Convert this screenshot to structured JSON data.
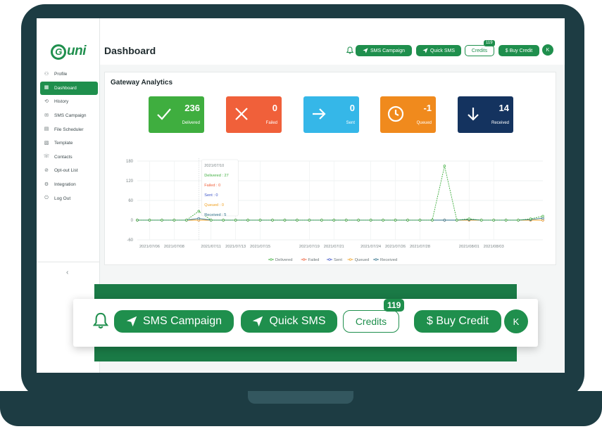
{
  "app": {
    "logo_text": "uni",
    "logo_letter": "G"
  },
  "sidebar": {
    "items": [
      {
        "label": "Profile",
        "icon": "user-icon",
        "glyph": "⚇"
      },
      {
        "label": "Dashboard",
        "icon": "dashboard-icon",
        "glyph": "▦",
        "active": true
      },
      {
        "label": "History",
        "icon": "history-icon",
        "glyph": "⟲"
      },
      {
        "label": "SMS Campaign",
        "icon": "envelope-icon",
        "glyph": "✉"
      },
      {
        "label": "File Scheduler",
        "icon": "file-icon",
        "glyph": "▤"
      },
      {
        "label": "Template",
        "icon": "template-icon",
        "glyph": "▧"
      },
      {
        "label": "Contacts",
        "icon": "contacts-icon",
        "glyph": "☏"
      },
      {
        "label": "Opt-out List",
        "icon": "opt-out-icon",
        "glyph": "⊘"
      },
      {
        "label": "Integration",
        "icon": "integration-icon",
        "glyph": "⚙"
      },
      {
        "label": "Log Out",
        "icon": "logout-icon",
        "glyph": "⏻"
      }
    ],
    "collapse_glyph": "‹"
  },
  "header": {
    "title": "Dashboard",
    "sms_campaign_label": "SMS Campaign",
    "quick_sms_label": "Quick SMS",
    "credits_label": "Credits",
    "credits_count": "119",
    "buy_credit_label": "$ Buy Credit",
    "avatar_initial": "K"
  },
  "analytics": {
    "title": "Gateway Analytics",
    "stats": [
      {
        "key": "delivered",
        "label": "Delivered",
        "value": "236",
        "color": "#3fae3f",
        "icon": "check-icon"
      },
      {
        "key": "failed",
        "label": "Failed",
        "value": "0",
        "color": "#f0603a",
        "icon": "x-icon"
      },
      {
        "key": "sent",
        "label": "Sent",
        "value": "0",
        "color": "#35b7e8",
        "icon": "arrow-right-icon"
      },
      {
        "key": "queued",
        "label": "Queued",
        "value": "-1",
        "color": "#f08a1d",
        "icon": "clock-icon"
      },
      {
        "key": "received",
        "label": "Received",
        "value": "14",
        "color": "#14335f",
        "icon": "arrow-down-icon"
      }
    ]
  },
  "chart_data": {
    "type": "line",
    "x": [
      "2021/07/05",
      "2021/07/06",
      "2021/07/07",
      "2021/07/08",
      "2021/07/09",
      "2021/07/10",
      "2021/07/11",
      "2021/07/12",
      "2021/07/13",
      "2021/07/14",
      "2021/07/15",
      "2021/07/16",
      "2021/07/17",
      "2021/07/18",
      "2021/07/19",
      "2021/07/20",
      "2021/07/21",
      "2021/07/22",
      "2021/07/23",
      "2021/07/24",
      "2021/07/25",
      "2021/07/26",
      "2021/07/27",
      "2021/07/28",
      "2021/07/29",
      "2021/07/30",
      "2021/07/31",
      "2021/08/01",
      "2021/08/02",
      "2021/08/03",
      "2021/08/04",
      "2021/08/05",
      "2021/08/06",
      "2021/08/07"
    ],
    "x_tick_labels": [
      "2021/07/06",
      "2021/07/08",
      "2021/07/11",
      "2021/07/13",
      "2021/07/15",
      "2021/07/19",
      "2021/07/21",
      "2021/07/24",
      "2021/07/26",
      "2021/07/28",
      "2021/08/01",
      "2021/08/03"
    ],
    "y_ticks": [
      -60,
      0,
      60,
      120,
      180
    ],
    "ylim": [
      -60,
      180
    ],
    "series": [
      {
        "name": "Delivered",
        "color": "#3fae3f",
        "values": [
          0,
          0,
          0,
          0,
          0,
          27,
          0,
          0,
          0,
          0,
          0,
          0,
          0,
          0,
          0,
          0,
          0,
          0,
          0,
          0,
          0,
          0,
          0,
          0,
          0,
          165,
          0,
          4,
          0,
          0,
          0,
          0,
          4,
          12
        ]
      },
      {
        "name": "Failed",
        "color": "#f0603a",
        "values": [
          0,
          0,
          0,
          0,
          0,
          0,
          0,
          0,
          0,
          0,
          0,
          0,
          0,
          0,
          0,
          0,
          0,
          0,
          0,
          0,
          0,
          0,
          0,
          0,
          0,
          0,
          0,
          0,
          0,
          0,
          0,
          0,
          0,
          0
        ]
      },
      {
        "name": "Sent",
        "color": "#3d54c8",
        "values": [
          0,
          0,
          0,
          0,
          0,
          0,
          0,
          0,
          0,
          0,
          0,
          0,
          0,
          0,
          0,
          0,
          0,
          0,
          0,
          0,
          0,
          0,
          0,
          0,
          0,
          0,
          0,
          0,
          0,
          0,
          0,
          0,
          0,
          0
        ]
      },
      {
        "name": "Queued",
        "color": "#f0a020",
        "values": [
          0,
          0,
          0,
          0,
          0,
          0,
          0,
          0,
          0,
          0,
          0,
          0,
          0,
          0,
          0,
          0,
          0,
          0,
          0,
          0,
          0,
          0,
          0,
          0,
          0,
          0,
          0,
          0,
          0,
          0,
          0,
          0,
          0,
          0
        ]
      },
      {
        "name": "Received",
        "color": "#2a6d86",
        "values": [
          0,
          0,
          0,
          0,
          0,
          5,
          0,
          0,
          0,
          0,
          0,
          0,
          0,
          0,
          0,
          0,
          0,
          0,
          0,
          0,
          0,
          0,
          0,
          0,
          0,
          0,
          0,
          2,
          0,
          0,
          0,
          0,
          2,
          6
        ]
      }
    ],
    "tooltip": {
      "date": "2021/07/10",
      "rows": [
        {
          "text": "Delivered : 27",
          "color": "#3fae3f"
        },
        {
          "text": "Failed : 0",
          "color": "#f0603a"
        },
        {
          "text": "Sent : 0",
          "color": "#3d54c8"
        },
        {
          "text": "Queued : 0",
          "color": "#f0a020"
        },
        {
          "text": "Received : 5",
          "color": "#2a6d86"
        }
      ]
    },
    "legend_position": "bottom-center",
    "grid": true
  },
  "zoom": {
    "sms_campaign_label": "SMS Campaign",
    "quick_sms_label": "Quick SMS",
    "credits_label": "Credits",
    "credits_count": "119",
    "buy_credit_label": "$ Buy Credit",
    "avatar_initial": "K"
  },
  "colors": {
    "brand": "#1f8f4d",
    "frame": "#1d3c43",
    "band": "#1a7a46"
  }
}
